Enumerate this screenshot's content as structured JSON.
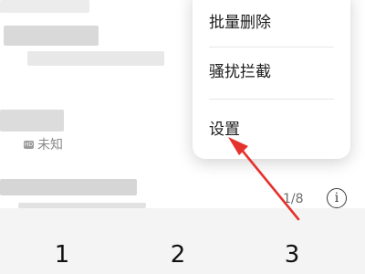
{
  "popup_menu": {
    "items": [
      {
        "label": "批量删除"
      },
      {
        "label": "骚扰拦截"
      },
      {
        "label": "设置"
      }
    ]
  },
  "call_list": {
    "entry_tag": "未知",
    "entry_sim_badge": "HD",
    "sim_count": "1/8"
  },
  "info_icon": {
    "glyph": "i"
  },
  "dialpad": {
    "keys": [
      {
        "digit": "1"
      },
      {
        "digit": "2"
      },
      {
        "digit": "3"
      }
    ]
  },
  "annotation": {
    "arrow_color": "#e5322d",
    "icon": "red-arrow-icon"
  }
}
